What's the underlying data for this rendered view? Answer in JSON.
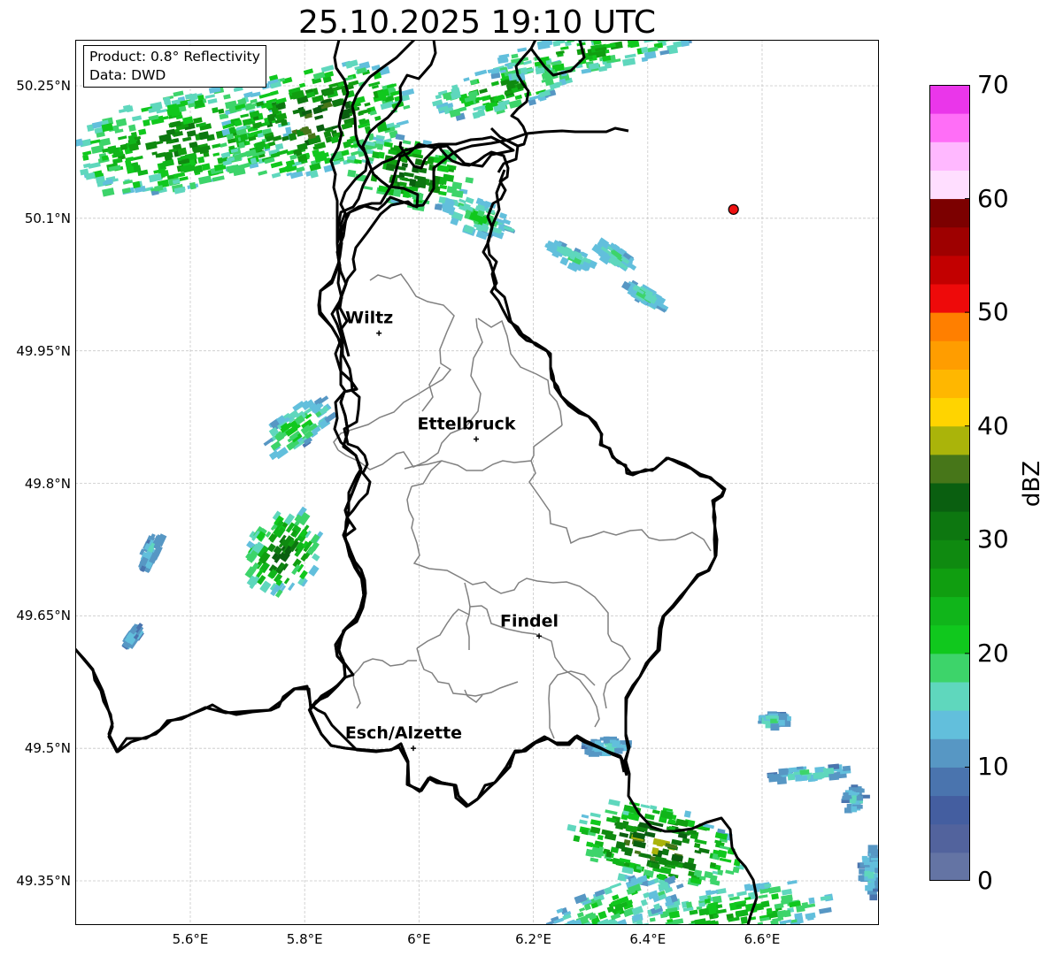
{
  "title": "25.10.2025 19:10 UTC",
  "info_box": {
    "product": "Product: 0.8° Reflectivity",
    "source": "Data: DWD"
  },
  "axes": {
    "longitude_ticks": [
      "5.6°E",
      "5.8°E",
      "6°E",
      "6.2°E",
      "6.4°E",
      "6.6°E"
    ],
    "latitude_ticks": [
      "50.25°N",
      "50.1°N",
      "49.95°N",
      "49.8°N",
      "49.65°N",
      "49.5°N",
      "49.35°N"
    ]
  },
  "cities": [
    {
      "name": "Wiltz",
      "lon": 5.93,
      "lat": 49.97
    },
    {
      "name": "Ettelbruck",
      "lon": 6.1,
      "lat": 49.85
    },
    {
      "name": "Findel",
      "lon": 6.21,
      "lat": 49.627
    },
    {
      "name": "Esch/Alzette",
      "lon": 5.99,
      "lat": 49.5
    }
  ],
  "marker": {
    "lon": 6.55,
    "lat": 50.11,
    "color": "#ee1111"
  },
  "colorbar": {
    "title": "dBZ",
    "tick_labels": [
      "0",
      "10",
      "20",
      "30",
      "40",
      "50",
      "60",
      "70"
    ],
    "colors": [
      "#6474a4",
      "#52639d",
      "#445ea0",
      "#4a74ae",
      "#5797c4",
      "#62bfdc",
      "#5fd7bd",
      "#3dd46a",
      "#10c81d",
      "#10b51a",
      "#109e10",
      "#0f8a10",
      "#0d7710",
      "#0a5f10",
      "#477619",
      "#aab40a",
      "#ffd400",
      "#ffb700",
      "#ff9d00",
      "#ff7f00",
      "#ee0a0a",
      "#c20000",
      "#9e0000",
      "#7c0000",
      "#ffdeff",
      "#ffb8ff",
      "#ff6ef7",
      "#ea36ea"
    ]
  }
}
